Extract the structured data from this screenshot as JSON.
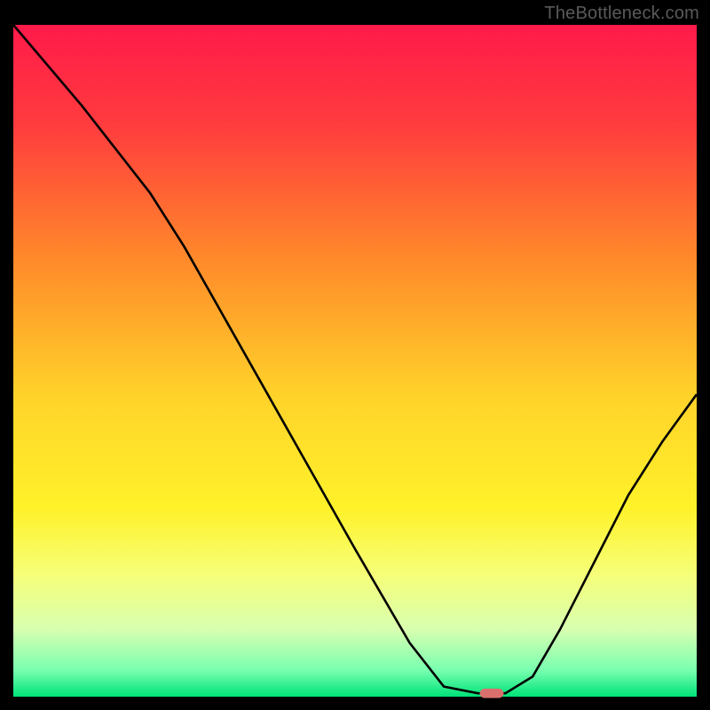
{
  "attribution": "TheBottleneck.com",
  "chart_data": {
    "type": "line",
    "title": "",
    "xlabel": "",
    "ylabel": "",
    "x_range": [
      0,
      100
    ],
    "y_range": [
      0,
      100
    ],
    "background_gradient": {
      "stops": [
        {
          "offset": 0.0,
          "color": "#ff1a4a"
        },
        {
          "offset": 0.15,
          "color": "#ff3c3e"
        },
        {
          "offset": 0.35,
          "color": "#ff8a2a"
        },
        {
          "offset": 0.55,
          "color": "#ffd22a"
        },
        {
          "offset": 0.72,
          "color": "#fff22a"
        },
        {
          "offset": 0.82,
          "color": "#f5ff7a"
        },
        {
          "offset": 0.9,
          "color": "#d8ffb0"
        },
        {
          "offset": 0.96,
          "color": "#7affb0"
        },
        {
          "offset": 1.0,
          "color": "#00e37a"
        }
      ]
    },
    "curve": [
      {
        "x": 0,
        "y": 100
      },
      {
        "x": 10,
        "y": 88
      },
      {
        "x": 20,
        "y": 75
      },
      {
        "x": 25,
        "y": 67
      },
      {
        "x": 30,
        "y": 58
      },
      {
        "x": 40,
        "y": 40
      },
      {
        "x": 50,
        "y": 22
      },
      {
        "x": 58,
        "y": 8
      },
      {
        "x": 63,
        "y": 1.5
      },
      {
        "x": 68,
        "y": 0.5
      },
      {
        "x": 72,
        "y": 0.5
      },
      {
        "x": 76,
        "y": 3
      },
      {
        "x": 80,
        "y": 10
      },
      {
        "x": 85,
        "y": 20
      },
      {
        "x": 90,
        "y": 30
      },
      {
        "x": 95,
        "y": 38
      },
      {
        "x": 100,
        "y": 45
      }
    ],
    "marker": {
      "x": 70,
      "y": 0.5,
      "color": "#d9706e",
      "width": 3.5,
      "height": 1.4
    },
    "axis_color": "#000000",
    "curve_color": "#000000",
    "frame_color": "#000000"
  }
}
